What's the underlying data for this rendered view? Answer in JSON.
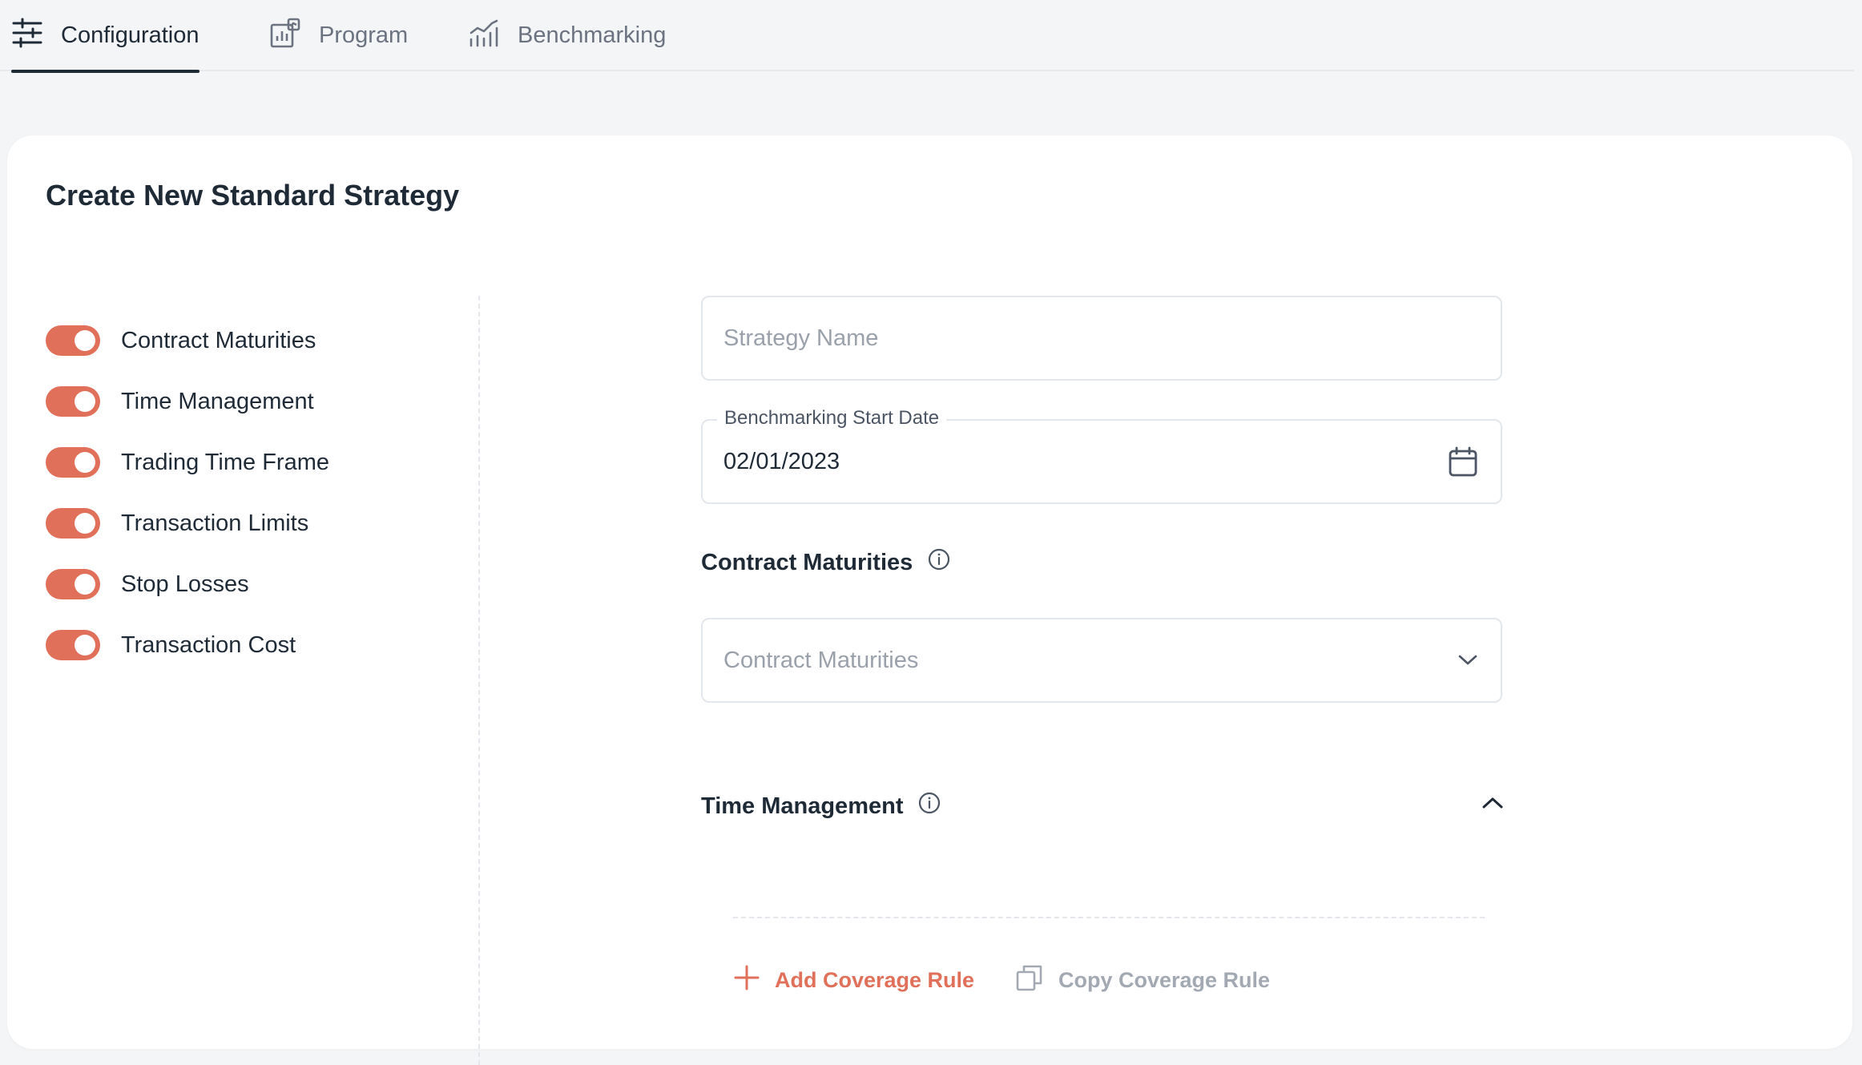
{
  "tabs": [
    {
      "label": "Configuration",
      "icon": "sliders-icon",
      "active": true
    },
    {
      "label": "Program",
      "icon": "program-chart-icon",
      "active": false
    },
    {
      "label": "Benchmarking",
      "icon": "trend-chart-icon",
      "active": false
    }
  ],
  "card": {
    "title": "Create New Standard Strategy"
  },
  "toggles": [
    {
      "label": "Contract Maturities",
      "on": true
    },
    {
      "label": "Time Management",
      "on": true
    },
    {
      "label": "Trading Time Frame",
      "on": true
    },
    {
      "label": "Transaction Limits",
      "on": true
    },
    {
      "label": "Stop Losses",
      "on": true
    },
    {
      "label": "Transaction Cost",
      "on": true
    }
  ],
  "form": {
    "strategy_name": {
      "placeholder": "Strategy Name",
      "value": ""
    },
    "start_date": {
      "label": "Benchmarking Start Date",
      "value": "02/01/2023"
    },
    "contract_maturities": {
      "title": "Contract Maturities",
      "placeholder": "Contract Maturities"
    },
    "time_management": {
      "title": "Time Management"
    },
    "add_rule_label": "Add Coverage Rule",
    "copy_rule_label": "Copy Coverage Rule"
  },
  "colors": {
    "accent": "#e0705a",
    "text": "#1f2a37",
    "muted": "#9aa1ab"
  }
}
